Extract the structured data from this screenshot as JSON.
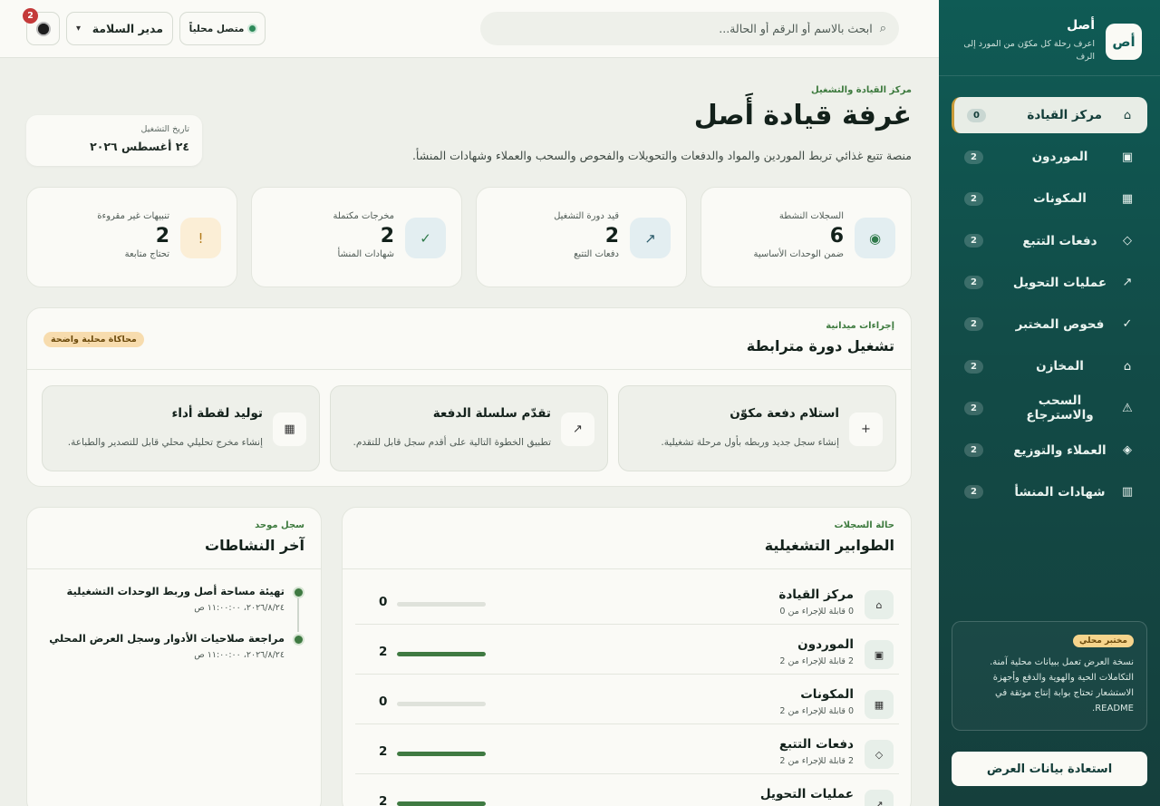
{
  "brand": {
    "logo_text": "أص",
    "name": "أصل",
    "tagline": "اعرف رحلة كل مكوّن من المورد إلى الرف"
  },
  "nav": [
    {
      "label": "مركز القيادة",
      "count": "0",
      "icon": "home-icon",
      "glyph": "⌂",
      "active": true
    },
    {
      "label": "الموردون",
      "count": "2",
      "icon": "supplier-icon",
      "glyph": "▣"
    },
    {
      "label": "المكونات",
      "count": "2",
      "icon": "grid-icon",
      "glyph": "▦"
    },
    {
      "label": "دفعات التتبع",
      "count": "2",
      "icon": "diamond-icon",
      "glyph": "◇"
    },
    {
      "label": "عمليات التحويل",
      "count": "2",
      "icon": "arrow-icon",
      "glyph": "↗"
    },
    {
      "label": "فحوص المختبر",
      "count": "2",
      "icon": "check-icon",
      "glyph": "✓"
    },
    {
      "label": "المخازن",
      "count": "2",
      "icon": "warehouse-icon",
      "glyph": "⌂"
    },
    {
      "label": "السحب والاسترجاع",
      "count": "2",
      "icon": "warning-icon",
      "glyph": "⚠"
    },
    {
      "label": "العملاء والتوزيع",
      "count": "2",
      "icon": "distribution-icon",
      "glyph": "◈"
    },
    {
      "label": "شهادات المنشأ",
      "count": "2",
      "icon": "certificate-icon",
      "glyph": "▥"
    }
  ],
  "lab": {
    "badge": "مختبر محلي",
    "text": "نسخة العرض تعمل ببيانات محلية آمنة. التكاملات الحية والهوية والدفع وأجهزة الاستشعار تحتاج بوابة إنتاج موثقة في README."
  },
  "restore_label": "استعادة بيانات العرض",
  "topbar": {
    "search_placeholder": "ابحث بالاسم أو الرقم أو الحالة...",
    "status": "متصل محلياً",
    "role": "مدير السلامة",
    "notif_count": "2"
  },
  "header": {
    "eyebrow": "مركز القيادة والتشغيل",
    "title": "غرفة قيادة أَصل",
    "description": "منصة تتبع غذائي تربط الموردين والمواد والدفعات والتحويلات والفحوص والسحب والعملاء وشهادات المنشأ.",
    "date_label": "تاريخ التشغيل",
    "date_value": "٢٤ أغسطس ٢٠٢٦"
  },
  "stats": [
    {
      "label": "السجلات النشطة",
      "value": "6",
      "sub": "ضمن الوحدات الأساسية",
      "icon": "target-icon",
      "glyph": "◉",
      "bg": "#e3eef1",
      "fg": "#2f7a4a"
    },
    {
      "label": "قيد دورة التشغيل",
      "value": "2",
      "sub": "دفعات التتبع",
      "icon": "trend-icon",
      "glyph": "↗",
      "bg": "#e3eef1",
      "fg": "#2a5a6a"
    },
    {
      "label": "مخرجات مكتملة",
      "value": "2",
      "sub": "شهادات المنشأ",
      "icon": "check-icon",
      "glyph": "✓",
      "bg": "#e3eef1",
      "fg": "#2f7a4a"
    },
    {
      "label": "تنبيهات غير مقروءة",
      "value": "2",
      "sub": "تحتاج متابعة",
      "icon": "alert-icon",
      "glyph": "!",
      "bg": "#fbeed6",
      "fg": "#b37a1a"
    }
  ],
  "actions": {
    "eyebrow": "إجراءات ميدانية",
    "title": "تشغيل دورة مترابطة",
    "badge": "محاكاة محلية واضحة",
    "items": [
      {
        "title": "استلام دفعة مكوّن",
        "desc": "إنشاء سجل جديد وربطه بأول مرحلة تشغيلية.",
        "icon": "plus-icon",
        "glyph": "+"
      },
      {
        "title": "تقدّم سلسلة الدفعة",
        "desc": "تطبيق الخطوة التالية على أقدم سجل قابل للتقدم.",
        "icon": "advance-icon",
        "glyph": "↗"
      },
      {
        "title": "توليد لقطة أداء",
        "desc": "إنشاء مخرج تحليلي محلي قابل للتصدير والطباعة.",
        "icon": "report-icon",
        "glyph": "▦"
      }
    ]
  },
  "queues": {
    "eyebrow": "حالة السجلات",
    "title": "الطوابير التشغيلية",
    "items": [
      {
        "name": "مركز القيادة",
        "sub": "0 قابلة للإجراء من 0",
        "value": "0",
        "fill": 0,
        "icon": "home-icon",
        "glyph": "⌂"
      },
      {
        "name": "الموردون",
        "sub": "2 قابلة للإجراء من 2",
        "value": "2",
        "fill": 1,
        "icon": "supplier-icon",
        "glyph": "▣"
      },
      {
        "name": "المكونات",
        "sub": "0 قابلة للإجراء من 2",
        "value": "0",
        "fill": 0,
        "icon": "grid-icon",
        "glyph": "▦"
      },
      {
        "name": "دفعات التتبع",
        "sub": "2 قابلة للإجراء من 2",
        "value": "2",
        "fill": 1,
        "icon": "diamond-icon",
        "glyph": "◇"
      },
      {
        "name": "عمليات التحويل",
        "sub": "",
        "value": "2",
        "fill": 1,
        "icon": "arrow-icon",
        "glyph": "↗"
      }
    ]
  },
  "activity": {
    "eyebrow": "سجل موحد",
    "title": "آخر النشاطات",
    "items": [
      {
        "title": "تهيئة مساحة أصل وربط الوحدات التشغيلية",
        "time": "٢٠٢٦/٨/٢٤، ١١:٠٠:٠٠ ص"
      },
      {
        "title": "مراجعة صلاحيات الأدوار وسجل العرض المحلي",
        "time": "٢٠٢٦/٨/٢٤، ١١:٠٠:٠٠ ص"
      }
    ]
  }
}
